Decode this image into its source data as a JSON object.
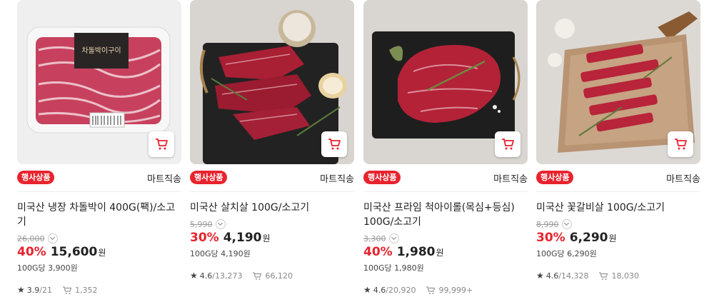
{
  "products": [
    {
      "badge": "행사상품",
      "shipping": "마트직송",
      "name": "미국산 냉장 차돌박이 400G(팩)/소고기",
      "original_price": "26,000",
      "discount_rate": "40%",
      "price": "15,600",
      "currency": "원",
      "unit_price": "100G당 3,900원",
      "rating": "3.9",
      "review_count": "/21",
      "cart_count": "1,352",
      "package_label": "차돌박이구이"
    },
    {
      "badge": "행사상품",
      "shipping": "마트직송",
      "name": "미국산 살치살 100G/소고기",
      "original_price": "5,990",
      "discount_rate": "30%",
      "price": "4,190",
      "currency": "원",
      "unit_price": "100G당 4,190원",
      "rating": "4.6",
      "review_count": "/13,273",
      "cart_count": "66,120"
    },
    {
      "badge": "행사상품",
      "shipping": "마트직송",
      "name": "미국산 프라임 척아이롤(목심+등심) 100G/소고기",
      "original_price": "3,300",
      "discount_rate": "40%",
      "price": "1,980",
      "currency": "원",
      "unit_price": "100G당 1,980원",
      "rating": "4.6",
      "review_count": "/20,920",
      "cart_count": "99,999+"
    },
    {
      "badge": "행사상품",
      "shipping": "마트직송",
      "name": "미국산 꽃갈비살 100G/소고기",
      "original_price": "8,990",
      "discount_rate": "30%",
      "price": "6,290",
      "currency": "원",
      "unit_price": "100G당 6,290원",
      "rating": "4.6",
      "review_count": "/14,328",
      "cart_count": "18,030"
    }
  ],
  "colors": {
    "accent": "#e8232e",
    "muted": "#999999"
  },
  "icons": {
    "cart": "cart-icon",
    "star": "star-icon",
    "chevron": "chevron-down-icon"
  }
}
